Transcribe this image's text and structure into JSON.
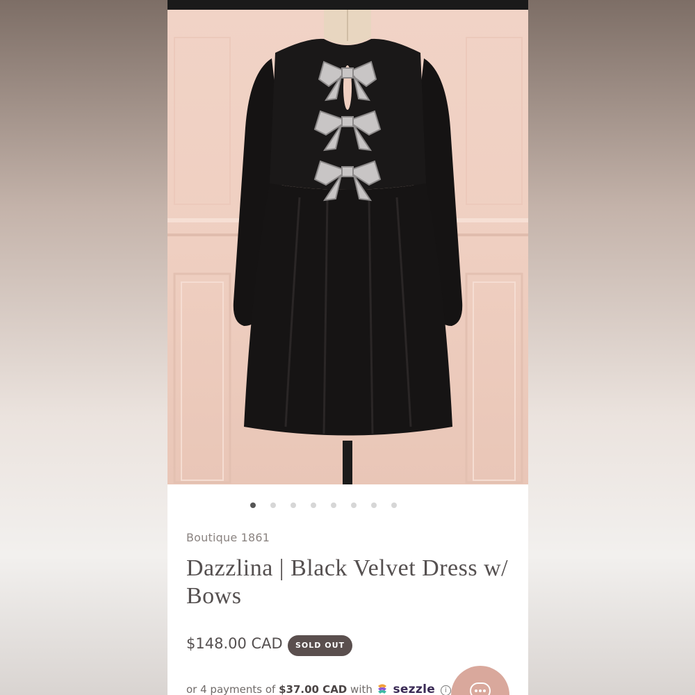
{
  "product": {
    "brand": "Boutique 1861",
    "title": "Dazzlina | Black Velvet Dress w/ Bows",
    "price": "$148.00 CAD",
    "badge": "SOLD OUT",
    "image_alt": "black velvet dress with rhinestone bows on mannequin"
  },
  "carousel": {
    "total_slides": 8,
    "active_index": 0
  },
  "payments": {
    "prefix": "or 4 payments of",
    "amount": "$37.00 CAD",
    "with": "with",
    "provider": "sezzle",
    "info_icon": "info-icon"
  },
  "chat": {
    "icon": "chat-bubble-icon"
  },
  "colors": {
    "badge_bg": "#5a4f4e",
    "chat_fab": "#d9a89c",
    "wall": "#efcfc1",
    "dress": "#141212"
  }
}
